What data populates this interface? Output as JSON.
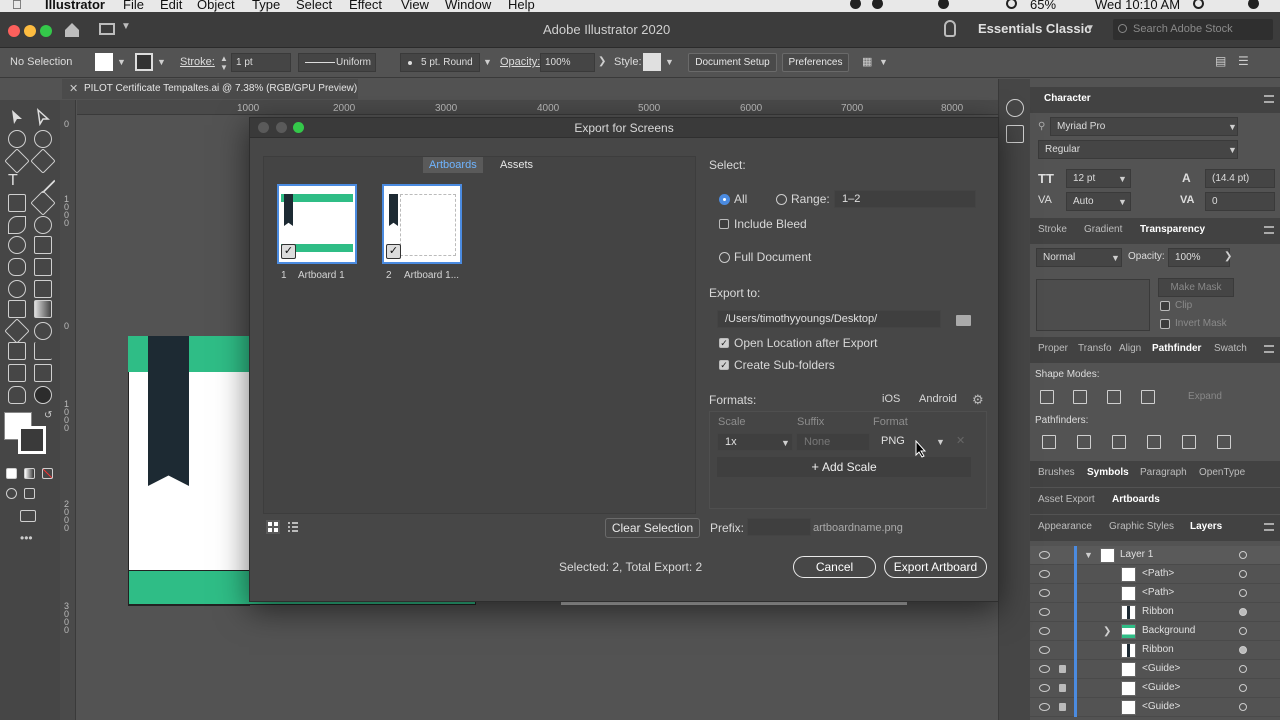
{
  "menubar": {
    "app": "Illustrator",
    "items": [
      "File",
      "Edit",
      "Object",
      "Type",
      "Select",
      "Effect",
      "View",
      "Window",
      "Help"
    ],
    "battery": "65%",
    "clock": "Wed 10:10 AM"
  },
  "appbar": {
    "title": "Adobe Illustrator 2020",
    "workspace": "Essentials Classic",
    "search_placeholder": "Search Adobe Stock"
  },
  "control": {
    "selection": "No Selection",
    "stroke_label": "Stroke:",
    "stroke_value": "1 pt",
    "profile": "Uniform",
    "brush": "5 pt. Round",
    "opacity_label": "Opacity:",
    "opacity_value": "100%",
    "style_label": "Style:",
    "doc_setup": "Document Setup",
    "preferences": "Preferences"
  },
  "document_tab": "PILOT Certificate Tempaltes.ai @ 7.38% (RGB/GPU Preview)",
  "rulers": {
    "top": [
      "1000",
      "2000",
      "3000",
      "4000",
      "5000",
      "6000",
      "7000",
      "8000"
    ],
    "left": [
      "0",
      "1000",
      "0",
      "1000",
      "2000",
      "3000"
    ]
  },
  "dialog": {
    "title": "Export for Screens",
    "tab_artboards": "Artboards",
    "tab_assets": "Assets",
    "thumbnails": [
      {
        "num": "1",
        "name": "Artboard 1"
      },
      {
        "num": "2",
        "name": "Artboard 1..."
      }
    ],
    "clear_selection": "Clear Selection",
    "select_heading": "Select:",
    "opt_all": "All",
    "opt_range": "Range:",
    "range_value": "1–2",
    "include_bleed": "Include Bleed",
    "full_document": "Full Document",
    "export_to": "Export to:",
    "path": "/Users/timothyyoungs/Desktop/",
    "open_location": "Open Location after Export",
    "create_subfolders": "Create Sub-folders",
    "formats_heading": "Formats:",
    "ios": "iOS",
    "android": "Android",
    "col_scale": "Scale",
    "col_suffix": "Suffix",
    "col_format": "Format",
    "scale_value": "1x",
    "suffix_placeholder": "None",
    "format_value": "PNG",
    "add_scale": "Add Scale",
    "prefix_label": "Prefix:",
    "prefix_value": "",
    "prefix_hint": "artboardname.png",
    "status": "Selected: 2, Total Export: 2",
    "cancel": "Cancel",
    "export_button": "Export Artboard"
  },
  "character_panel": {
    "title": "Character",
    "font": "Myriad Pro",
    "style": "Regular",
    "size": "12 pt",
    "leading": "(14.4 pt)",
    "kerning": "Auto",
    "tracking": "0"
  },
  "transparency_panel": {
    "tabs": [
      "Stroke",
      "Gradient",
      "Transparency"
    ],
    "mode": "Normal",
    "opacity_label": "Opacity:",
    "opacity_value": "100%",
    "make_mask": "Make Mask",
    "clip": "Clip",
    "invert_mask": "Invert Mask"
  },
  "pathfinder_panel": {
    "tabs": [
      "Proper",
      "Transfo",
      "Align",
      "Pathfinder",
      "Swatch"
    ],
    "shape_modes": "Shape Modes:",
    "expand": "Expand",
    "pathfinders": "Pathfinders:"
  },
  "symbols_tabs": [
    "Brushes",
    "Symbols",
    "Paragraph",
    "OpenType"
  ],
  "asset_tabs": [
    "Asset Export",
    "Artboards"
  ],
  "layers_tabs": [
    "Appearance",
    "Graphic Styles",
    "Layers"
  ],
  "layers": [
    {
      "name": "Layer 1"
    },
    {
      "name": "<Path>"
    },
    {
      "name": "<Path>"
    },
    {
      "name": "Ribbon"
    },
    {
      "name": "Background"
    },
    {
      "name": "Ribbon"
    },
    {
      "name": "<Guide>"
    },
    {
      "name": "<Guide>"
    },
    {
      "name": "<Guide>"
    }
  ],
  "colors": {
    "accent_blue": "#4b8be0",
    "artwork_green": "#2fbd86",
    "ribbon_navy": "#1d2a33"
  }
}
